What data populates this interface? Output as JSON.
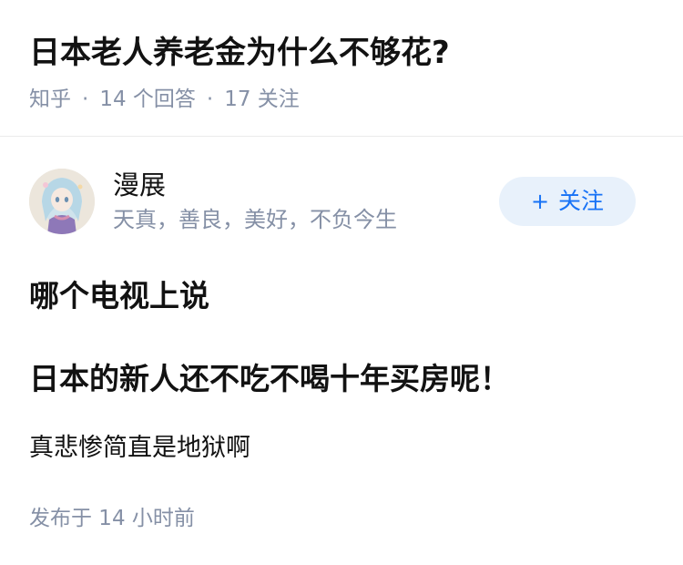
{
  "question": {
    "title": "日本老人养老金为什么不够花?",
    "meta": {
      "source": "知乎",
      "separator": "·",
      "answers": "14  个回答",
      "followers": "17  关注"
    }
  },
  "author": {
    "avatar_icon": "avatar-anime-girl",
    "name": "漫展",
    "bio": "天真，善良，美好，不负今生",
    "follow_button": {
      "plus": "+",
      "label": "关注"
    }
  },
  "answer": {
    "bold_lines": [
      "哪个电视上说",
      "日本的新人还不吃不喝十年买房呢！"
    ],
    "normal_line": "真悲惨简直是地狱啊",
    "published": "发布于  14 小时前"
  },
  "colors": {
    "text": "#121212",
    "muted": "#8590a6",
    "accent": "#1772f6",
    "follow_bg": "#e8f1fb",
    "divider": "#ebebeb"
  }
}
